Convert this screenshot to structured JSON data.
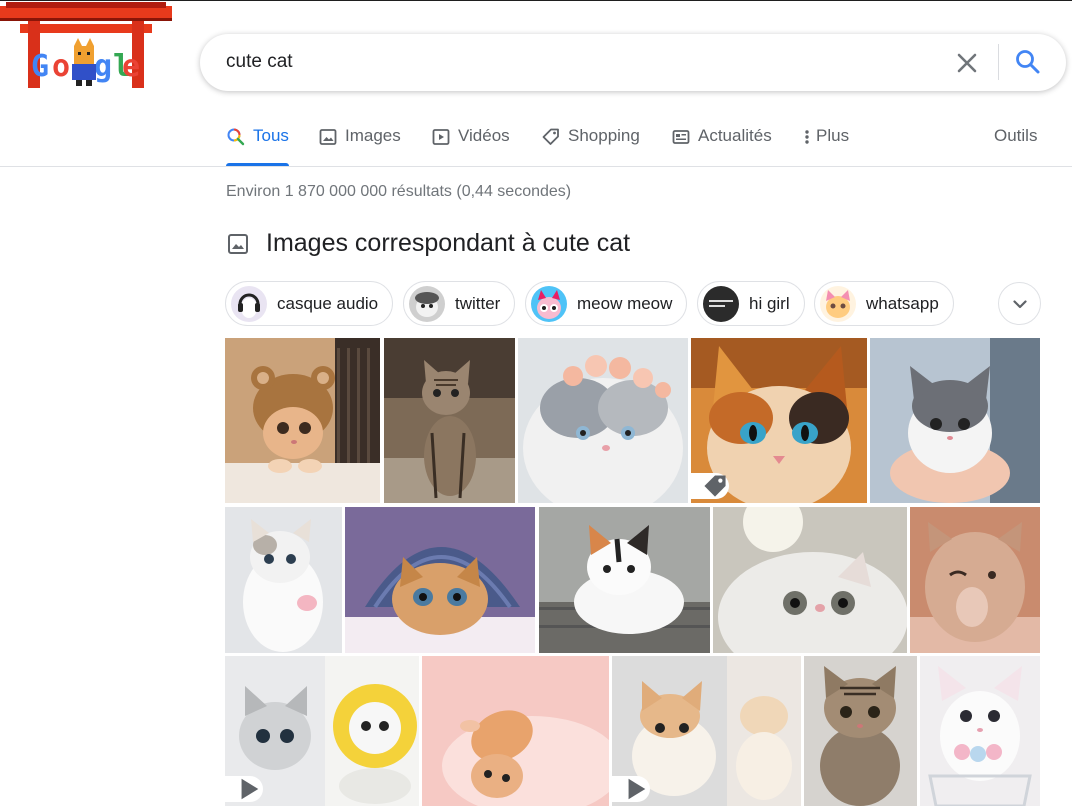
{
  "logo": {
    "alt": "Google"
  },
  "search": {
    "query": "cute cat",
    "placeholder": ""
  },
  "tabs": [
    {
      "label": "Tous",
      "icon": "search-icon",
      "active": true
    },
    {
      "label": "Images",
      "icon": "image-icon"
    },
    {
      "label": "Vidéos",
      "icon": "video-icon"
    },
    {
      "label": "Shopping",
      "icon": "tag-icon"
    },
    {
      "label": "Actualités",
      "icon": "news-icon"
    },
    {
      "label": "Plus",
      "icon": "more-vert-icon"
    }
  ],
  "tools_label": "Outils",
  "result_stats": "Environ 1 870 000 000 résultats (0,44 secondes)",
  "images_section": {
    "title": "Images correspondant à cute cat"
  },
  "chips": [
    {
      "label": "casque audio"
    },
    {
      "label": "twitter"
    },
    {
      "label": "meow meow"
    },
    {
      "label": "hi girl"
    },
    {
      "label": "whatsapp"
    }
  ],
  "colors": {
    "accent": "#1a73e8",
    "text": "#202124",
    "muted": "#70757a",
    "border": "#dfe1e5"
  }
}
